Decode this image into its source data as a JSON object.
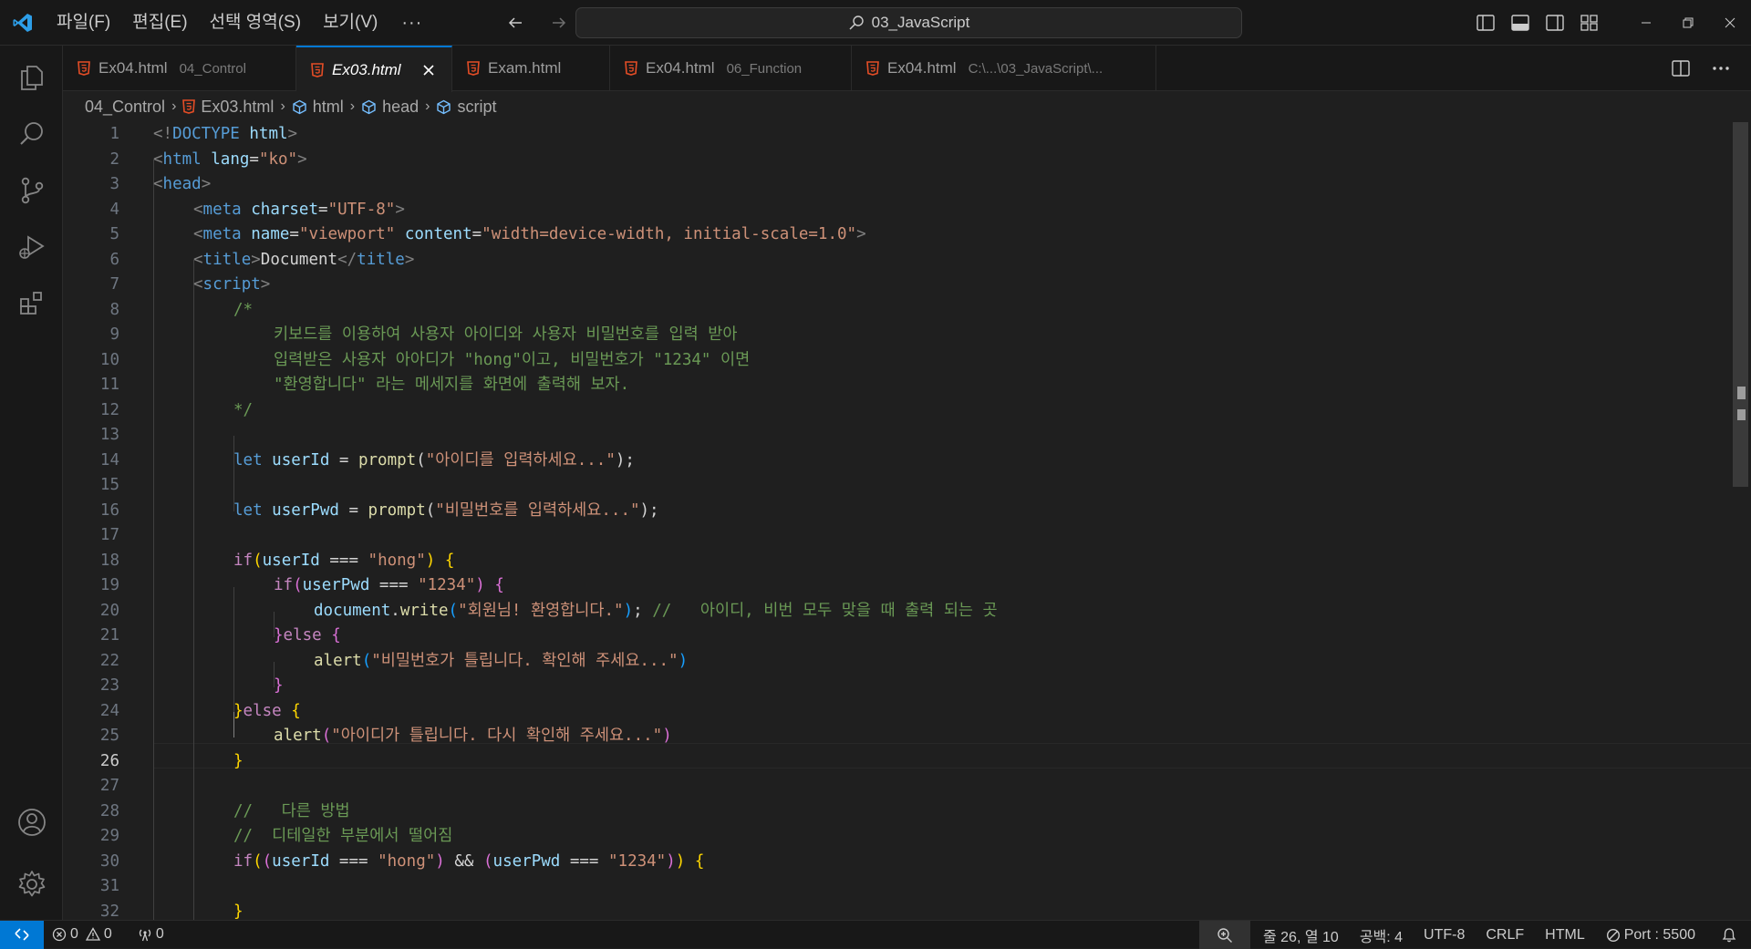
{
  "titlebar": {
    "menus": [
      "파일(F)",
      "편집(E)",
      "선택 영역(S)",
      "보기(V)"
    ],
    "more": "···",
    "command_center": "03_JavaScript"
  },
  "tabs": [
    {
      "label": "Ex04.html",
      "desc": "04_Control",
      "active": false
    },
    {
      "label": "Ex03.html",
      "desc": "",
      "active": true
    },
    {
      "label": "Exam.html",
      "desc": "",
      "active": false
    },
    {
      "label": "Ex04.html",
      "desc": "06_Function",
      "active": false
    },
    {
      "label": "Ex04.html",
      "desc": "C:\\...\\03_JavaScript\\...",
      "active": false
    }
  ],
  "breadcrumb": {
    "folder": "04_Control",
    "file": "Ex03.html",
    "sym1": "html",
    "sym2": "head",
    "sym3": "script"
  },
  "editor": {
    "current_line": 26,
    "lines": [
      {
        "n": "1",
        "indent": 0,
        "tokens": [
          [
            "br",
            "<!"
          ],
          [
            "tag",
            "DOCTYPE"
          ],
          [
            "txt",
            " "
          ],
          [
            "attr",
            "html"
          ],
          [
            "br",
            ">"
          ]
        ]
      },
      {
        "n": "2",
        "indent": 0,
        "tokens": [
          [
            "br",
            "<"
          ],
          [
            "tag",
            "html"
          ],
          [
            "txt",
            " "
          ],
          [
            "attr",
            "lang"
          ],
          [
            "txt",
            "="
          ],
          [
            "str",
            "\"ko\""
          ],
          [
            "br",
            ">"
          ]
        ]
      },
      {
        "n": "3",
        "indent": 0,
        "tokens": [
          [
            "br",
            "<"
          ],
          [
            "tag",
            "head"
          ],
          [
            "br",
            ">"
          ]
        ]
      },
      {
        "n": "4",
        "indent": 1,
        "tokens": [
          [
            "br",
            "<"
          ],
          [
            "tag",
            "meta"
          ],
          [
            "txt",
            " "
          ],
          [
            "attr",
            "charset"
          ],
          [
            "txt",
            "="
          ],
          [
            "str",
            "\"UTF-8\""
          ],
          [
            "br",
            ">"
          ]
        ]
      },
      {
        "n": "5",
        "indent": 1,
        "tokens": [
          [
            "br",
            "<"
          ],
          [
            "tag",
            "meta"
          ],
          [
            "txt",
            " "
          ],
          [
            "attr",
            "name"
          ],
          [
            "txt",
            "="
          ],
          [
            "str",
            "\"viewport\""
          ],
          [
            "txt",
            " "
          ],
          [
            "attr",
            "content"
          ],
          [
            "txt",
            "="
          ],
          [
            "str",
            "\"width=device-width, initial-scale=1.0\""
          ],
          [
            "br",
            ">"
          ]
        ]
      },
      {
        "n": "6",
        "indent": 1,
        "tokens": [
          [
            "br",
            "<"
          ],
          [
            "tag",
            "title"
          ],
          [
            "br",
            ">"
          ],
          [
            "txt",
            "Document"
          ],
          [
            "br",
            "</"
          ],
          [
            "tag",
            "title"
          ],
          [
            "br",
            ">"
          ]
        ]
      },
      {
        "n": "7",
        "indent": 1,
        "tokens": [
          [
            "br",
            "<"
          ],
          [
            "tag",
            "script"
          ],
          [
            "br",
            ">"
          ]
        ]
      },
      {
        "n": "8",
        "indent": 2,
        "tokens": [
          [
            "cmt",
            "/*"
          ]
        ]
      },
      {
        "n": "9",
        "indent": 3,
        "tokens": [
          [
            "cmt",
            "키보드를 이용하여 사용자 아이디와 사용자 비밀번호를 입력 받아"
          ]
        ]
      },
      {
        "n": "10",
        "indent": 3,
        "tokens": [
          [
            "cmt",
            "입력받은 사용자 아아디가 \"hong\"이고, 비밀번호가 \"1234\" 이면"
          ]
        ]
      },
      {
        "n": "11",
        "indent": 3,
        "tokens": [
          [
            "cmt",
            "\"환영합니다\" 라는 메세지를 화면에 출력해 보자."
          ]
        ]
      },
      {
        "n": "12",
        "indent": 2,
        "tokens": [
          [
            "cmt",
            "*/"
          ]
        ]
      },
      {
        "n": "13",
        "indent": 0,
        "tokens": []
      },
      {
        "n": "14",
        "indent": 2,
        "tokens": [
          [
            "kw",
            "let"
          ],
          [
            "txt",
            " "
          ],
          [
            "var",
            "userId"
          ],
          [
            "txt",
            " = "
          ],
          [
            "fn",
            "prompt"
          ],
          [
            "txt",
            "("
          ],
          [
            "str",
            "\"아이디를 입력하세요...\""
          ],
          [
            "txt",
            ");"
          ]
        ]
      },
      {
        "n": "15",
        "indent": 0,
        "tokens": []
      },
      {
        "n": "16",
        "indent": 2,
        "tokens": [
          [
            "kw",
            "let"
          ],
          [
            "txt",
            " "
          ],
          [
            "var",
            "userPwd"
          ],
          [
            "txt",
            " = "
          ],
          [
            "fn",
            "prompt"
          ],
          [
            "txt",
            "("
          ],
          [
            "str",
            "\"비밀번호를 입력하세요...\""
          ],
          [
            "txt",
            ");"
          ]
        ]
      },
      {
        "n": "17",
        "indent": 0,
        "tokens": []
      },
      {
        "n": "18",
        "indent": 2,
        "tokens": [
          [
            "ctl",
            "if"
          ],
          [
            "p1",
            "("
          ],
          [
            "var",
            "userId"
          ],
          [
            "txt",
            " === "
          ],
          [
            "str",
            "\"hong\""
          ],
          [
            "p1",
            ")"
          ],
          [
            "txt",
            " "
          ],
          [
            "p1",
            "{"
          ]
        ]
      },
      {
        "n": "19",
        "indent": 3,
        "tokens": [
          [
            "ctl",
            "if"
          ],
          [
            "p2",
            "("
          ],
          [
            "var",
            "userPwd"
          ],
          [
            "txt",
            " === "
          ],
          [
            "str",
            "\"1234\""
          ],
          [
            "p2",
            ")"
          ],
          [
            "txt",
            " "
          ],
          [
            "p2",
            "{"
          ]
        ]
      },
      {
        "n": "20",
        "indent": 4,
        "tokens": [
          [
            "var",
            "document"
          ],
          [
            "txt",
            "."
          ],
          [
            "fn",
            "write"
          ],
          [
            "p3",
            "("
          ],
          [
            "str",
            "\"회원님! 환영합니다.\""
          ],
          [
            "p3",
            ")"
          ],
          [
            "txt",
            ";"
          ],
          [
            "cmt",
            " //   아이디, 비번 모두 맞을 때 출력 되는 곳"
          ]
        ]
      },
      {
        "n": "21",
        "indent": 3,
        "tokens": [
          [
            "p2",
            "}"
          ],
          [
            "ctl",
            "else"
          ],
          [
            "txt",
            " "
          ],
          [
            "p2",
            "{"
          ]
        ]
      },
      {
        "n": "22",
        "indent": 4,
        "tokens": [
          [
            "fn",
            "alert"
          ],
          [
            "p3",
            "("
          ],
          [
            "str",
            "\"비밀번호가 틀립니다. 확인해 주세요...\""
          ],
          [
            "p3",
            ")"
          ]
        ]
      },
      {
        "n": "23",
        "indent": 3,
        "tokens": [
          [
            "p2",
            "}"
          ]
        ]
      },
      {
        "n": "24",
        "indent": 2,
        "tokens": [
          [
            "p1",
            "}"
          ],
          [
            "ctl",
            "else"
          ],
          [
            "txt",
            " "
          ],
          [
            "p1",
            "{"
          ]
        ]
      },
      {
        "n": "25",
        "indent": 3,
        "tokens": [
          [
            "fn",
            "alert"
          ],
          [
            "p2",
            "("
          ],
          [
            "str",
            "\"아이디가 틀립니다. 다시 확인해 주세요...\""
          ],
          [
            "p2",
            ")"
          ]
        ]
      },
      {
        "n": "26",
        "indent": 2,
        "tokens": [
          [
            "p1",
            "}"
          ]
        ]
      },
      {
        "n": "27",
        "indent": 0,
        "tokens": []
      },
      {
        "n": "28",
        "indent": 2,
        "tokens": [
          [
            "cmt",
            "//   다른 방법"
          ]
        ]
      },
      {
        "n": "29",
        "indent": 2,
        "tokens": [
          [
            "cmt",
            "//  디테일한 부분에서 떨어짐"
          ]
        ]
      },
      {
        "n": "30",
        "indent": 2,
        "tokens": [
          [
            "ctl",
            "if"
          ],
          [
            "p1",
            "("
          ],
          [
            "p2",
            "("
          ],
          [
            "var",
            "userId"
          ],
          [
            "txt",
            " === "
          ],
          [
            "str",
            "\"hong\""
          ],
          [
            "p2",
            ")"
          ],
          [
            "txt",
            " && "
          ],
          [
            "p2",
            "("
          ],
          [
            "var",
            "userPwd"
          ],
          [
            "txt",
            " === "
          ],
          [
            "str",
            "\"1234\""
          ],
          [
            "p2",
            ")"
          ],
          [
            "p1",
            ")"
          ],
          [
            "txt",
            " "
          ],
          [
            "p1",
            "{"
          ]
        ]
      },
      {
        "n": "31",
        "indent": 0,
        "tokens": []
      },
      {
        "n": "32",
        "indent": 2,
        "tokens": [
          [
            "p1",
            "}"
          ]
        ]
      }
    ]
  },
  "statusbar": {
    "errors": "0",
    "warnings": "0",
    "ports": "0",
    "cursor": "줄 26, 열 10",
    "spaces": "공백: 4",
    "encoding": "UTF-8",
    "eol": "CRLF",
    "language": "HTML",
    "port": "Port : 5500"
  },
  "colors": {
    "accent": "#0078d4",
    "html_icon": "#e44d26"
  }
}
